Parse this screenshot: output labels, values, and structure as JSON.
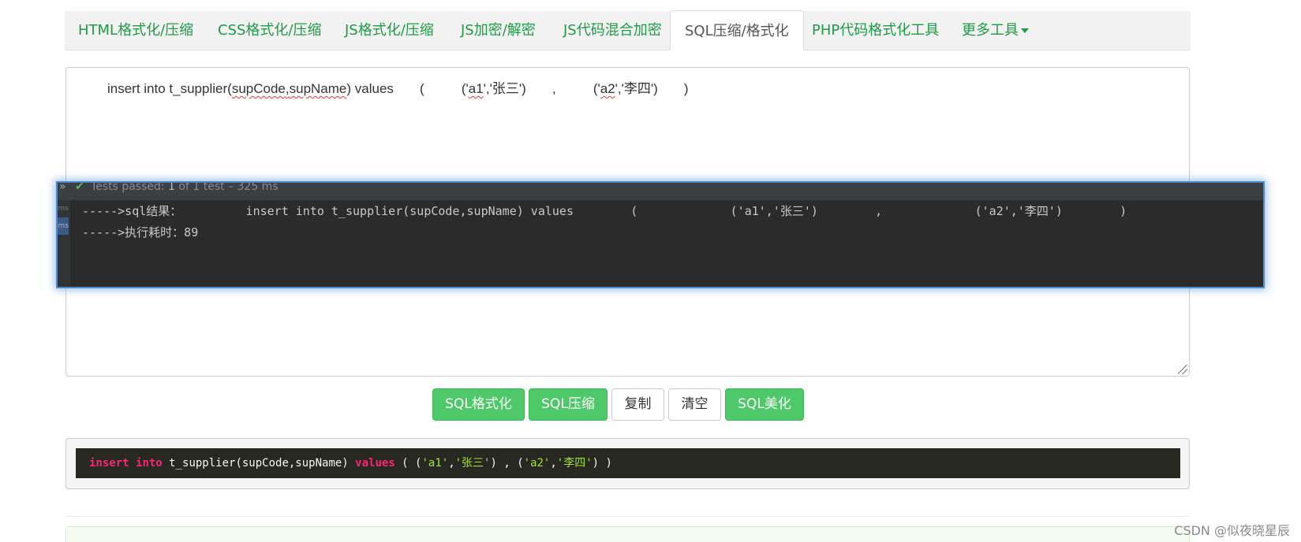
{
  "tabs": [
    {
      "label": "HTML格式化/压缩"
    },
    {
      "label": "CSS格式化/压缩"
    },
    {
      "label": "JS格式化/压缩"
    },
    {
      "label": "JS加密/解密"
    },
    {
      "label": "JS代码混合加密"
    },
    {
      "label": "SQL压缩/格式化"
    },
    {
      "label": "PHP代码格式化工具"
    },
    {
      "label": "更多工具"
    }
  ],
  "active_tab": "SQL压缩/格式化",
  "input": {
    "part1": "insert into t_supplier(",
    "part2": "supCode",
    "part3": ",",
    "part4": "supName",
    "part5": ") values       (          ('",
    "part6": "a1",
    "part7": "','张三')       ,          ('",
    "part8": "a2",
    "part9": "','李四')       )"
  },
  "console": {
    "header_status": "Tests passed:",
    "header_count": "1",
    "header_rest": "of 1 test – 325 ms",
    "gutter_label": "ms",
    "line1": "----->sql结果：         insert into t_supplier(supCode,supName) values        (             ('a1','张三')        ,             ('a2','李四')        )",
    "line2": "----->执行耗时：89"
  },
  "buttons": {
    "format": "SQL格式化",
    "compress": "SQL压缩",
    "copy": "复制",
    "clear": "清空",
    "beautify": "SQL美化"
  },
  "output": {
    "kw_insert": "insert",
    "kw_into": "into",
    "table": " t_supplier(supCode,supName) ",
    "kw_values": "values",
    "open": " ( (",
    "s1": "'a1'",
    "comma1": ",",
    "s2": "'张三'",
    "mid": ") , (",
    "s3": "'a2'",
    "comma2": ",",
    "s4": "'李四'",
    "close": ") )"
  },
  "watermark": "CSDN @似夜晓星辰"
}
